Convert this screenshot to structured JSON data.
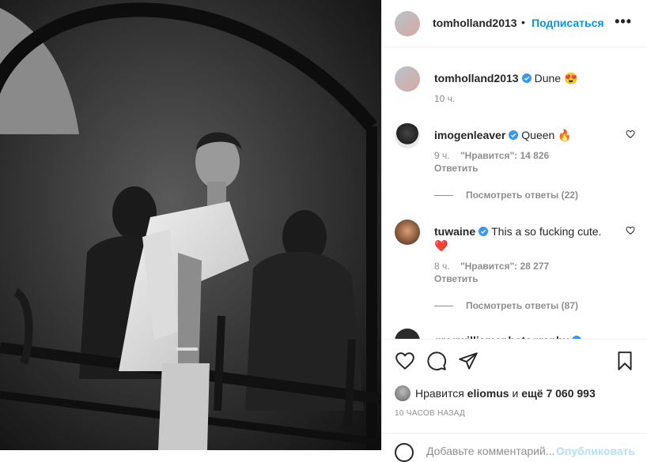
{
  "post": {
    "author": "tomholland2013",
    "follow_label": "Подписаться",
    "dot": "•",
    "more_label": "•••",
    "caption_text": "Dune 😍",
    "caption_time": "10 ч."
  },
  "comments": [
    {
      "username": "imogenleaver",
      "verified": true,
      "text": "Queen 🔥",
      "time": "9 ч.",
      "likes": "\"Нравится\": 14 826",
      "reply_label": "Ответить",
      "view_replies": "Посмотреть ответы (22)"
    },
    {
      "username": "tuwaine",
      "verified": true,
      "text": "This a so fucking cute. ❤️",
      "time": "8 ч.",
      "likes": "\"Нравится\": 28 277",
      "reply_label": "Ответить",
      "view_replies": "Посмотреть ответы (87)"
    },
    {
      "username": "gregwilliamsphotography",
      "verified": true,
      "text": ""
    }
  ],
  "actions": {
    "like_icon": "heart-icon",
    "comment_icon": "comment-icon",
    "share_icon": "paper-plane-icon",
    "save_icon": "bookmark-icon",
    "likes_prefix": "Нравится",
    "likes_user": "eliomus",
    "likes_mid": "и",
    "likes_count": "ещё 7 060 993",
    "time_ago": "10 часов назад"
  },
  "add_comment": {
    "placeholder": "Добавьте комментарий...",
    "post_label": "Опубликовать"
  },
  "colors": {
    "accent": "#0095f6",
    "text": "#262626",
    "muted": "#8e8e8e",
    "verified": "#3897f0"
  }
}
